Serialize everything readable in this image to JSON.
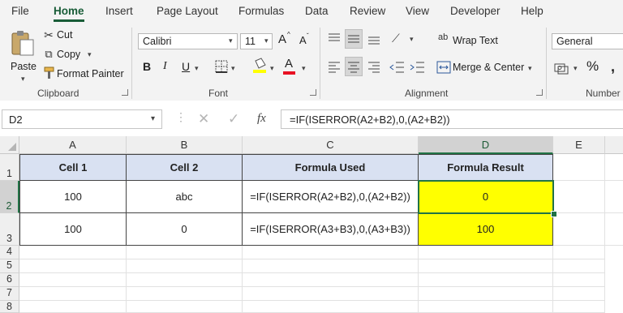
{
  "menu": [
    "File",
    "Home",
    "Insert",
    "Page Layout",
    "Formulas",
    "Data",
    "Review",
    "View",
    "Developer",
    "Help"
  ],
  "clipboard": {
    "paste": "Paste",
    "cut": "Cut",
    "copy": "Copy",
    "format_painter": "Format Painter",
    "label": "Clipboard"
  },
  "font": {
    "name": "Calibri",
    "size": "11",
    "bold": "B",
    "italic": "I",
    "underline": "U",
    "grow": "A",
    "shrink": "A",
    "color_letter": "A",
    "label": "Font"
  },
  "alignment": {
    "wrap": "Wrap Text",
    "merge": "Merge & Center",
    "label": "Alignment",
    "wrap_icon_text": "ab"
  },
  "number": {
    "format": "General",
    "percent": "%",
    "label": "Number"
  },
  "formula_bar": {
    "name_box": "D2",
    "fx": "fx",
    "formula": "=IF(ISERROR(A2+B2),0,(A2+B2))"
  },
  "columns": [
    "A",
    "B",
    "C",
    "D",
    "E"
  ],
  "rows": [
    "1",
    "2",
    "3",
    "4",
    "5",
    "6",
    "7",
    "8"
  ],
  "table": {
    "headers": [
      "Cell 1",
      "Cell 2",
      "Formula Used",
      "Formula Result"
    ],
    "rows": [
      [
        "100",
        "abc",
        "=IF(ISERROR(A2+B2),0,(A2+B2))",
        "0"
      ],
      [
        "100",
        "0",
        "=IF(ISERROR(A3+B3),0,(A3+B3))",
        "100"
      ]
    ]
  },
  "colors": {
    "accent": "#185c37",
    "header_fill": "#d9e1f2",
    "result_fill": "#ffff00",
    "ribbon": "#f3f3f3"
  }
}
